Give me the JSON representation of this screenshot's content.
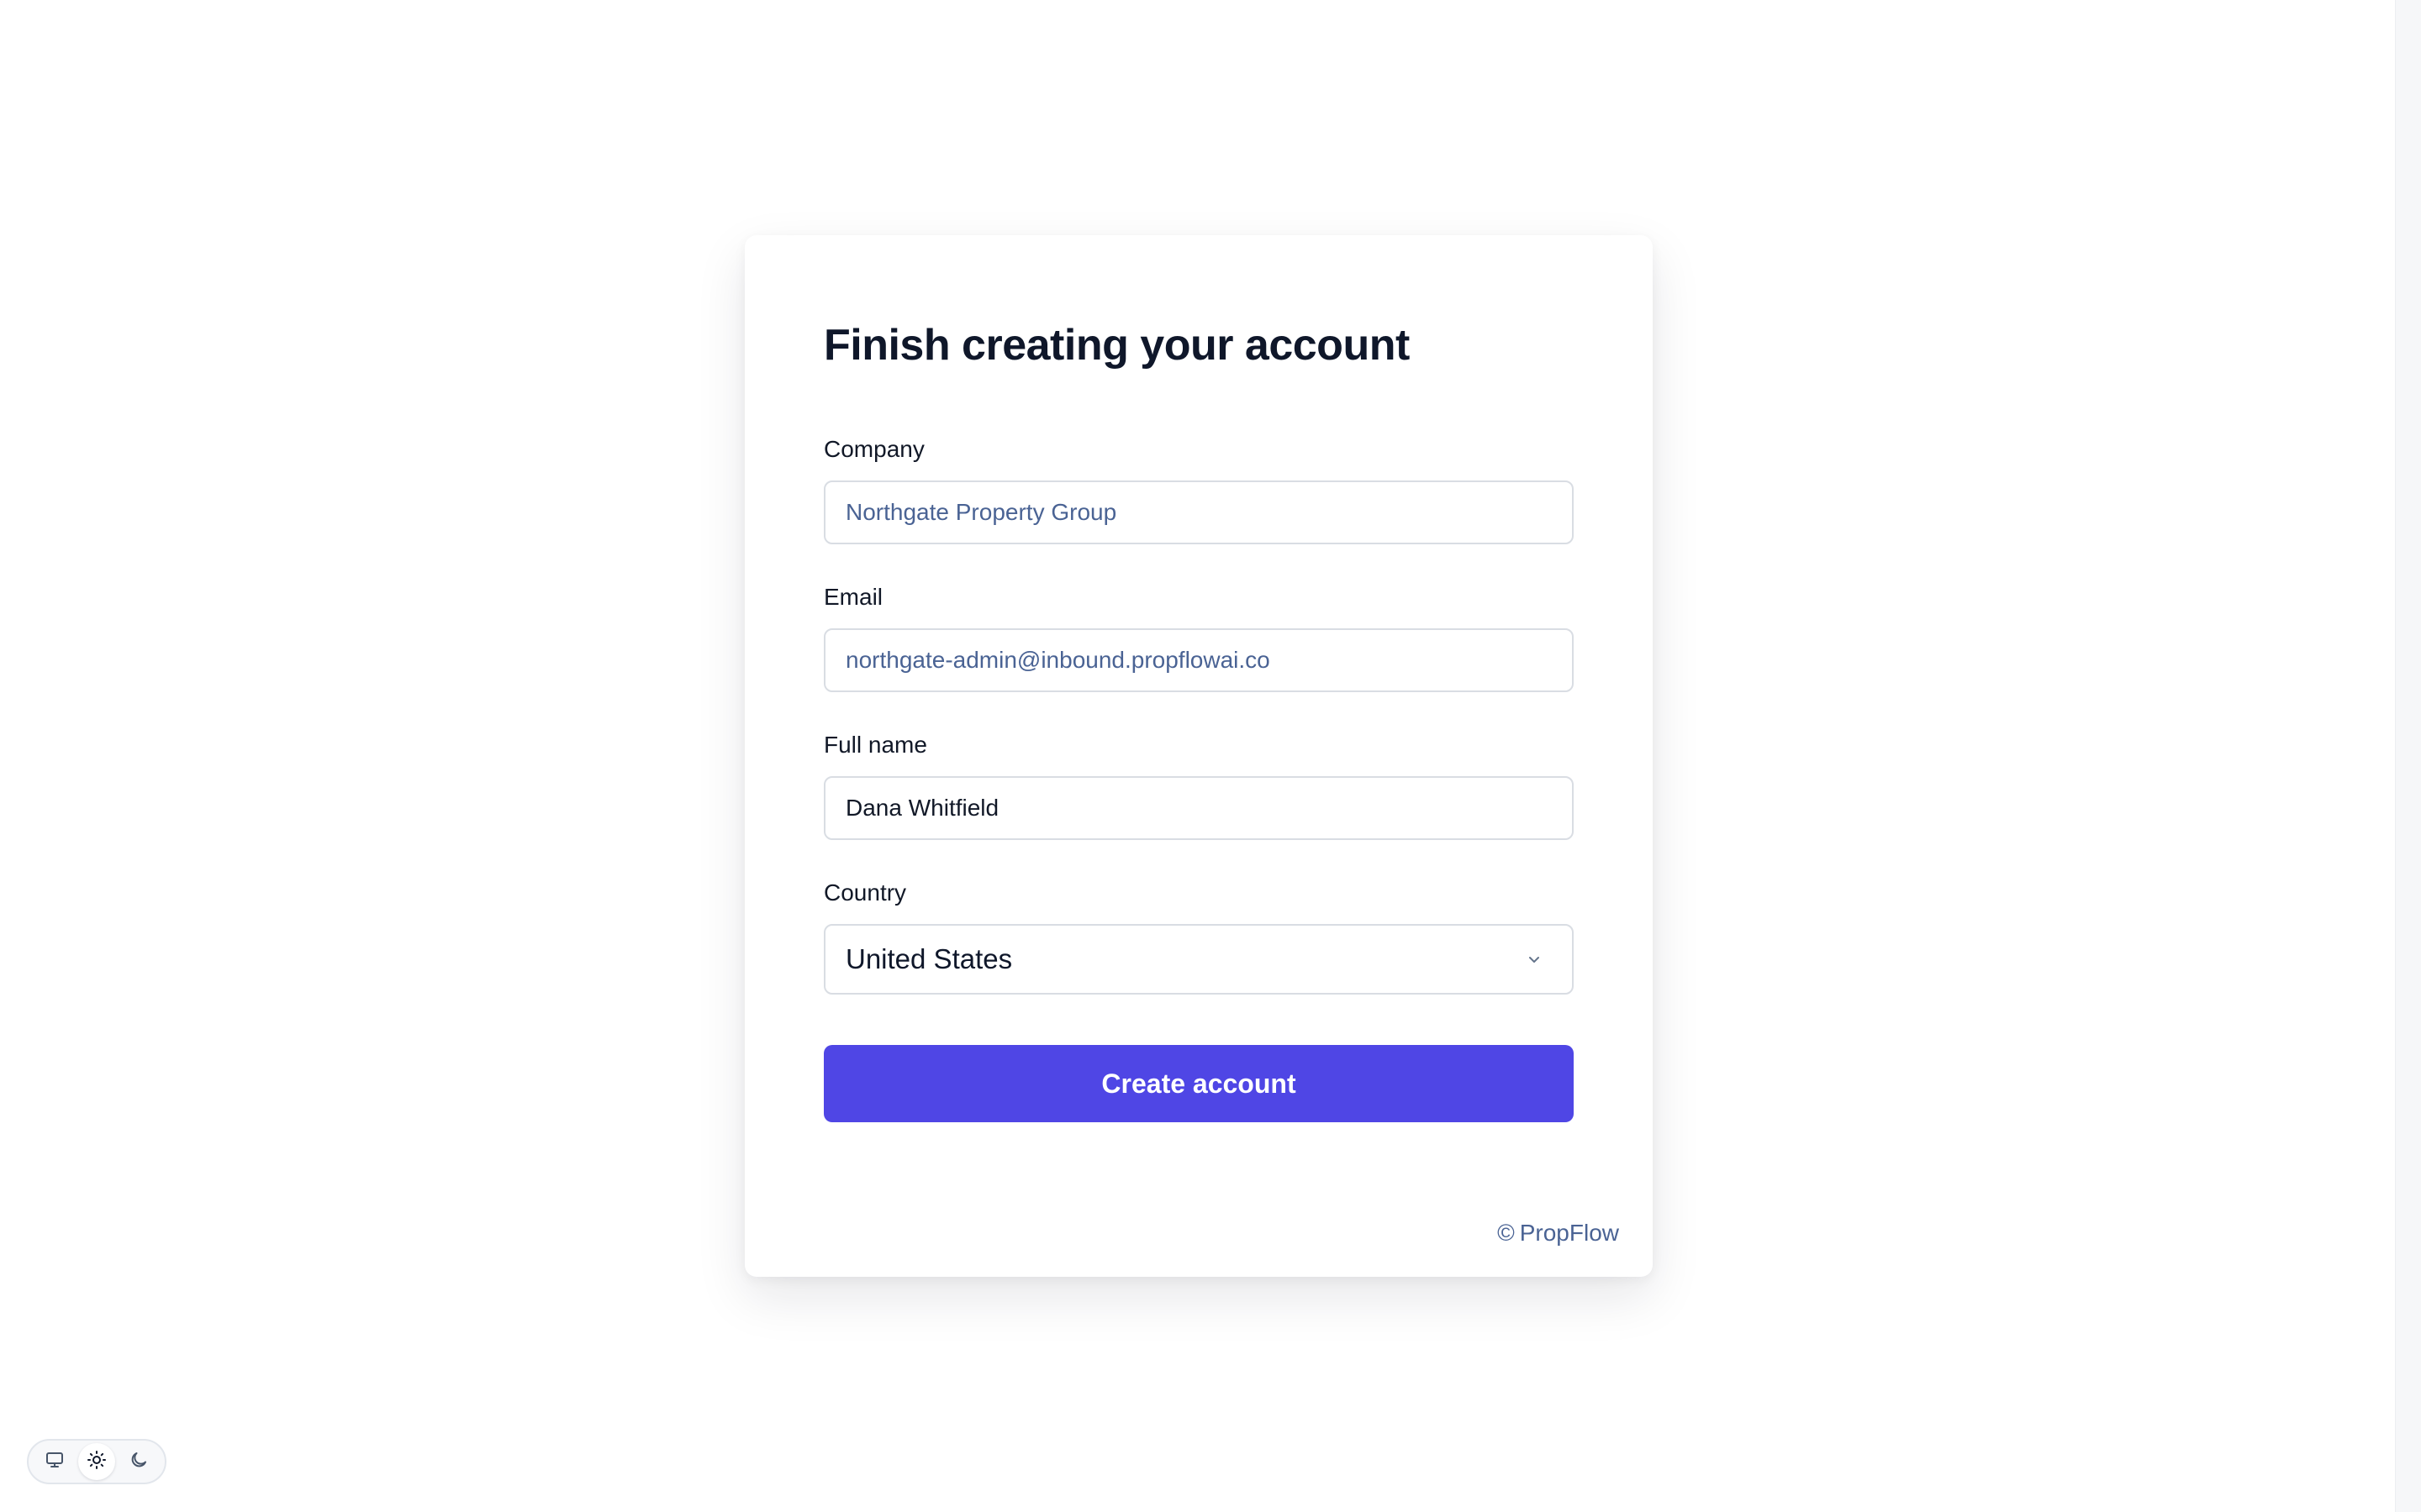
{
  "form": {
    "title": "Finish creating your account",
    "company": {
      "label": "Company",
      "value": "Northgate Property Group"
    },
    "email": {
      "label": "Email",
      "value": "northgate-admin@inbound.propflowai.co"
    },
    "full_name": {
      "label": "Full name",
      "value": "Dana Whitfield"
    },
    "country": {
      "label": "Country",
      "selected": "United States"
    },
    "submit_label": "Create account"
  },
  "footer": {
    "copyright_symbol": "©",
    "brand": "PropFlow"
  },
  "theme_switcher": {
    "options": [
      "monitor-icon",
      "sun-icon",
      "moon-icon"
    ],
    "active": "sun-icon"
  },
  "colors": {
    "accent": "#4f46e5",
    "title": "#0f172a",
    "muted_text": "#4a6394"
  }
}
